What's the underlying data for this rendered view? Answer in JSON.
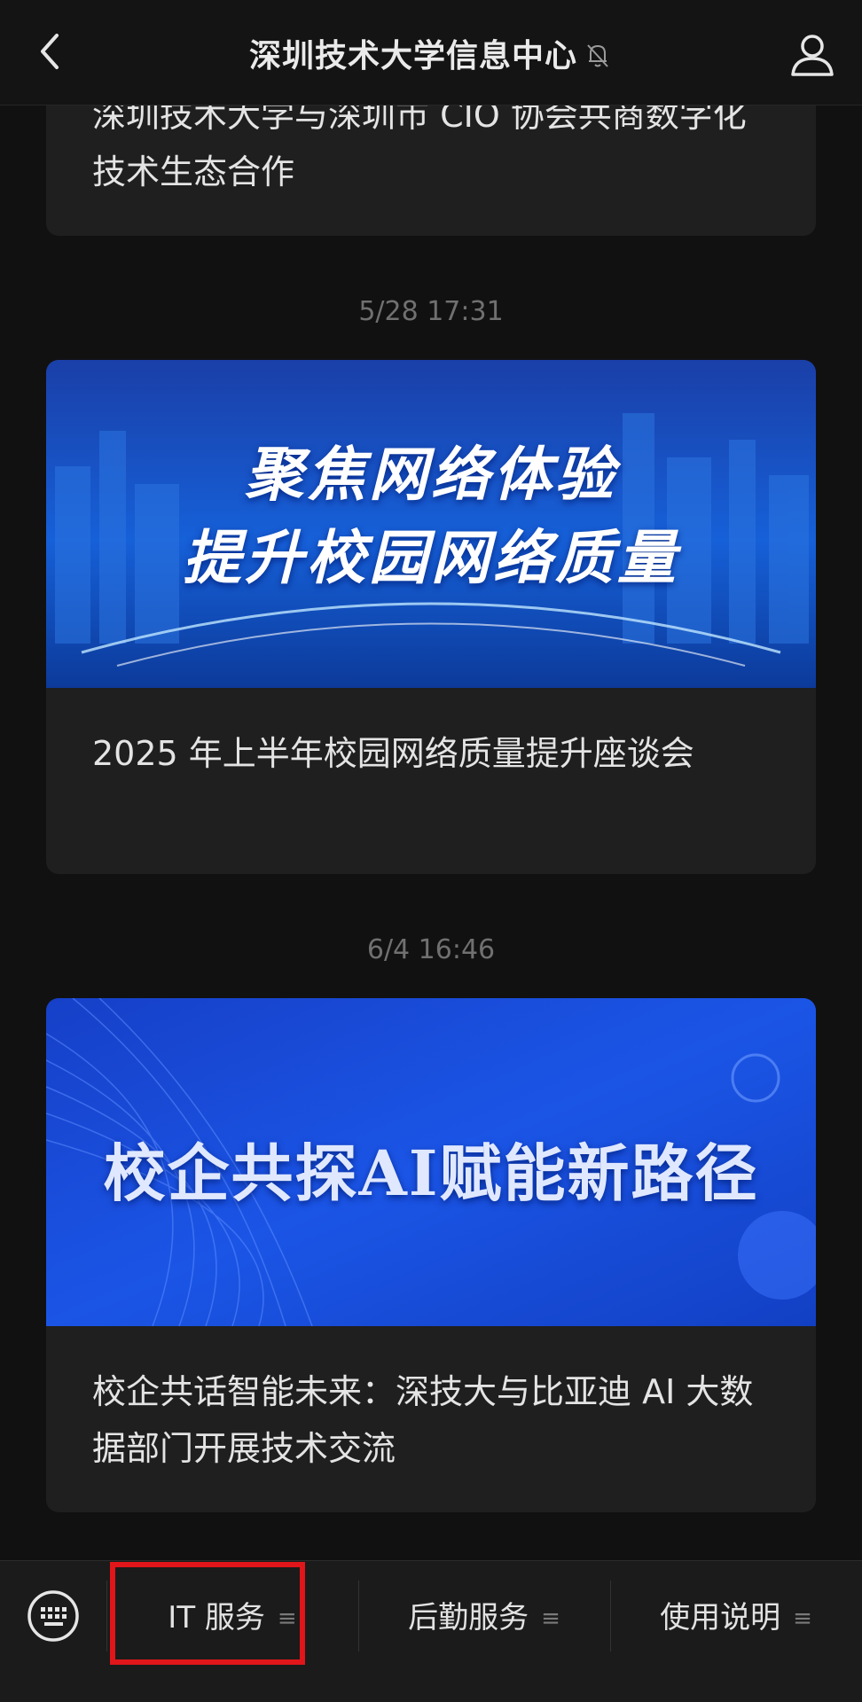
{
  "header": {
    "title": "深圳技术大学信息中心",
    "back_icon": "chevron-left-icon",
    "mute_icon": "bell-off-icon",
    "profile_icon": "person-icon"
  },
  "messages": [
    {
      "title": "深圳技术大学与深圳市 CIO 协会共商数字化技术生态合作"
    },
    {
      "timestamp": "5/28 17:31",
      "banner_lines": [
        "聚焦网络体验",
        "提升校园网络质量"
      ],
      "title": "2025 年上半年校园网络质量提升座谈会"
    },
    {
      "timestamp": "6/4 16:46",
      "banner_lines": [
        "校企共探AI赋能新路径"
      ],
      "title": "校企共话智能未来：深技大与比亚迪 AI 大数据部门开展技术交流"
    }
  ],
  "bottom_menu": {
    "keyboard_icon": "keyboard-icon",
    "items": [
      {
        "label": "IT 服务",
        "icon": "menu-lines-icon"
      },
      {
        "label": "后勤服务",
        "icon": "menu-lines-icon"
      },
      {
        "label": "使用说明",
        "icon": "menu-lines-icon"
      }
    ]
  },
  "colors": {
    "background": "#111111",
    "card": "#1f1f1f",
    "highlight": "#e0161a",
    "banner_blue": "#1a4fd8"
  }
}
